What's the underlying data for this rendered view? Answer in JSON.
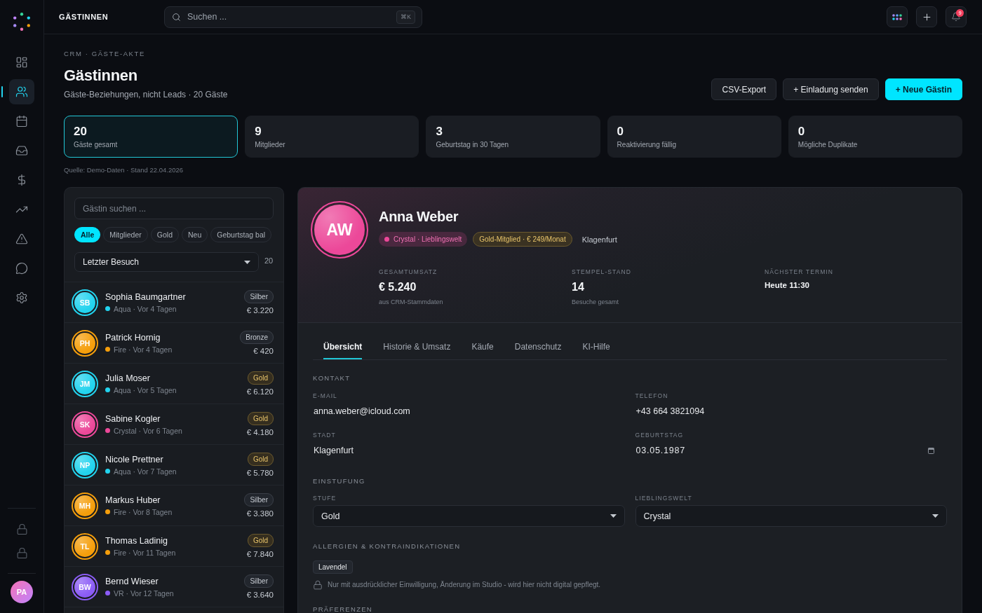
{
  "sidebar": {
    "items": [
      {
        "kind": "dashboard",
        "selected": false
      },
      {
        "kind": "guests",
        "selected": true
      },
      {
        "kind": "calendar",
        "selected": false
      },
      {
        "kind": "inbox",
        "selected": false
      },
      {
        "kind": "finance",
        "selected": false
      },
      {
        "kind": "trends",
        "selected": false
      },
      {
        "kind": "alerts",
        "selected": false
      },
      {
        "kind": "messages",
        "selected": false
      },
      {
        "kind": "settings",
        "selected": false
      }
    ],
    "bottom_items": [
      {
        "kind": "lock"
      },
      {
        "kind": "lock"
      }
    ],
    "user": {
      "initials": "PA"
    }
  },
  "topbar": {
    "title": "GÄSTINNEN",
    "search": {
      "placeholder": "Suchen ...",
      "shortcut": "⌘K"
    },
    "notifications": {
      "count": "9"
    }
  },
  "header": {
    "breadcrumb": "CRM · GÄSTE-AKTE",
    "title": "Gästinnen",
    "subtitle": "Gäste-Beziehungen, nicht Leads · 20 Gäste",
    "buttons": [
      {
        "label": "CSV-Export",
        "kind": "secondary"
      },
      {
        "label": "+ Einladung senden",
        "kind": "secondary"
      },
      {
        "label": "+ Neue Gästin",
        "kind": "primary"
      }
    ]
  },
  "stats": [
    {
      "value": "20",
      "label": "Gäste gesamt",
      "selected": true
    },
    {
      "value": "9",
      "label": "Mitglieder",
      "selected": false
    },
    {
      "value": "3",
      "label": "Geburtstag in 30 Tagen",
      "selected": false
    },
    {
      "value": "0",
      "label": "Reaktivierung fällig",
      "selected": false
    },
    {
      "value": "0",
      "label": "Mögliche Duplikate",
      "selected": false
    }
  ],
  "source_note": "Quelle: Demo-Daten · Stand 22.04.2026",
  "guest_list": {
    "search": {
      "placeholder": "Gästin suchen ..."
    },
    "filters": [
      {
        "label": "Alle",
        "selected": true
      },
      {
        "label": "Mitglieder",
        "selected": false
      },
      {
        "label": "Gold",
        "selected": false
      },
      {
        "label": "Neu",
        "selected": false
      },
      {
        "label": "Geburtstag bal",
        "selected": false
      }
    ],
    "sort": {
      "value": "Letzter Besuch"
    },
    "count": "20",
    "rows": [
      {
        "initials": "SB",
        "name": "Sophia Baumgartner",
        "meta": "Aqua · Vor 4 Tagen",
        "color": "#22d3ee",
        "tier": {
          "label": "Silber",
          "kind": "plain"
        },
        "amount": "€ 3.220"
      },
      {
        "initials": "PH",
        "name": "Patrick Hornig",
        "meta": "Fire · Vor 4 Tagen",
        "color": "#f59e0b",
        "tier": {
          "label": "Bronze",
          "kind": "plain"
        },
        "amount": "€ 420"
      },
      {
        "initials": "JM",
        "name": "Julia Moser",
        "meta": "Aqua · Vor 5 Tagen",
        "color": "#22d3ee",
        "tier": {
          "label": "Gold",
          "kind": "gold"
        },
        "amount": "€ 6.120"
      },
      {
        "initials": "SK",
        "name": "Sabine Kogler",
        "meta": "Crystal · Vor 6 Tagen",
        "color": "#ec4899",
        "tier": {
          "label": "Gold",
          "kind": "gold"
        },
        "amount": "€ 4.180"
      },
      {
        "initials": "NP",
        "name": "Nicole Prettner",
        "meta": "Aqua · Vor 7 Tagen",
        "color": "#22d3ee",
        "tier": {
          "label": "Gold",
          "kind": "gold"
        },
        "amount": "€ 5.780"
      },
      {
        "initials": "MH",
        "name": "Markus Huber",
        "meta": "Fire · Vor 8 Tagen",
        "color": "#f59e0b",
        "tier": {
          "label": "Silber",
          "kind": "plain"
        },
        "amount": "€ 3.380"
      },
      {
        "initials": "TL",
        "name": "Thomas Ladinig",
        "meta": "Fire · Vor 11 Tagen",
        "color": "#f59e0b",
        "tier": {
          "label": "Gold",
          "kind": "gold"
        },
        "amount": "€ 7.840"
      },
      {
        "initials": "BW",
        "name": "Bernd Wieser",
        "meta": "VR · Vor 12 Tagen",
        "color": "#8b5cf6",
        "tier": {
          "label": "Silber",
          "kind": "plain"
        },
        "amount": "€ 3.640"
      }
    ]
  },
  "detail": {
    "initials": "AW",
    "name": "Anna Weber",
    "tags": [
      {
        "label": "Crystal · Lieblingswelt",
        "kind": "world",
        "color": "#ec4899"
      },
      {
        "label": "Gold-Mitglied · € 249/Monat",
        "kind": "membership"
      },
      {
        "label": "Klagenfurt",
        "kind": "plain"
      }
    ],
    "metrics": [
      {
        "label": "GESAMTUMSATZ",
        "value": "€ 5.240",
        "note": "aus CRM-Stammdaten",
        "kind": "large"
      },
      {
        "label": "STEMPEL-STAND",
        "value": "14",
        "note": "Besuche gesamt",
        "kind": "large"
      },
      {
        "label": "NÄCHSTER TERMIN",
        "value": "Heute 11:30",
        "kind": "small"
      }
    ],
    "tabs": [
      {
        "label": "Übersicht",
        "selected": true
      },
      {
        "label": "Historie & Umsatz",
        "selected": false
      },
      {
        "label": "Käufe",
        "selected": false
      },
      {
        "label": "Datenschutz",
        "selected": false
      },
      {
        "label": "KI-Hilfe",
        "selected": false
      }
    ],
    "sections": [
      {
        "title": "KONTAKT",
        "fields": [
          {
            "label": "E-MAIL",
            "value": "anna.weber@icloud.com",
            "kind": "text"
          },
          {
            "label": "TELEFON",
            "value": "+43 664 3821094",
            "kind": "text"
          },
          {
            "label": "STADT",
            "value": "Klagenfurt",
            "kind": "text"
          },
          {
            "label": "GEBURTSTAG",
            "value": "03.05.1987",
            "kind": "date"
          }
        ]
      },
      {
        "title": "EINSTUFUNG",
        "fields": [
          {
            "label": "STUFE",
            "value": "Gold",
            "kind": "select"
          },
          {
            "label": "LIEBLINGSWELT",
            "value": "Crystal",
            "kind": "select"
          }
        ]
      },
      {
        "title": "ALLERGIEN & KONTRAINDIKATIONEN",
        "chips": [
          "Lavendel"
        ],
        "note": "Nur mit ausdrücklicher Einwilligung, Änderung im Studio - wird hier nicht digital gepflegt."
      },
      {
        "title": "PRÄFERENZEN"
      }
    ]
  }
}
